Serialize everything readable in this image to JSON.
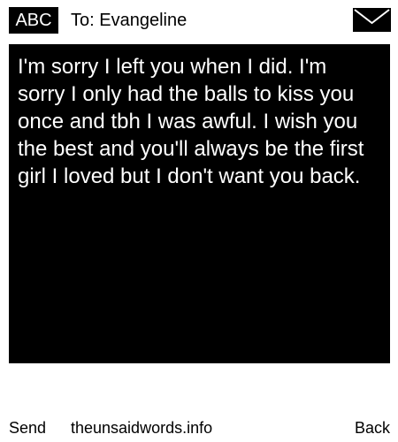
{
  "header": {
    "mode_label": "ABC",
    "recipient": "To: Evangeline",
    "envelope_icon": "envelope-icon"
  },
  "message": {
    "text": "I'm sorry I left you when I did. I'm sorry I only had the balls to kiss you once and tbh I was awful. I wish you the best and you'll always be the first girl I loved but I don't want you back."
  },
  "footer": {
    "send_label": "Send",
    "site_label": "theunsaidwords.info",
    "back_label": "Back"
  },
  "colors": {
    "background": "#ffffff",
    "message_background": "#000000",
    "message_text": "#ffffff",
    "accent": "#000000"
  }
}
